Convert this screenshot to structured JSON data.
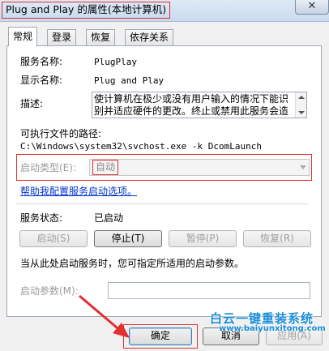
{
  "window": {
    "title": "Plug and Play 的属性(本地计算机)",
    "close_symbol": "✕"
  },
  "tabs": [
    {
      "label": "常规",
      "active": true
    },
    {
      "label": "登录",
      "active": false
    },
    {
      "label": "恢复",
      "active": false
    },
    {
      "label": "依存关系",
      "active": false
    }
  ],
  "general": {
    "service_name_label": "服务名称:",
    "service_name_value": "PlugPlay",
    "display_name_label": "显示名称:",
    "display_name_value": "Plug and Play",
    "description_label": "描述:",
    "description_value": "使计算机在极少或没有用户输入的情况下能识别并适应硬件的更改。终止或禁用此服务会造",
    "exe_path_label": "可执行文件的路径:",
    "exe_path_value": "C:\\Windows\\system32\\svchost.exe -k DcomLaunch",
    "startup_type_label": "启动类型(E):",
    "startup_type_value": "自动",
    "help_link": "帮助我配置服务启动选项。",
    "service_status_label": "服务状态:",
    "service_status_value": "已启动",
    "start_button": "启动(S)",
    "stop_button": "停止(T)",
    "pause_button": "暂停(P)",
    "resume_button": "恢复(R)",
    "hint_text": "当从此处启动服务时，您可指定所适用的启动参数。",
    "start_params_label": "启动参数(M):",
    "start_params_value": ""
  },
  "footer": {
    "ok_button": "确定",
    "cancel_button": "取消",
    "apply_button": "应用(A)"
  },
  "watermark": {
    "line1": "白云一键重装系统",
    "line2": "www.baiyunxitong.com"
  },
  "colors": {
    "highlight": "#e03030",
    "link": "#0033cc",
    "watermark": "#1a8fd8"
  }
}
